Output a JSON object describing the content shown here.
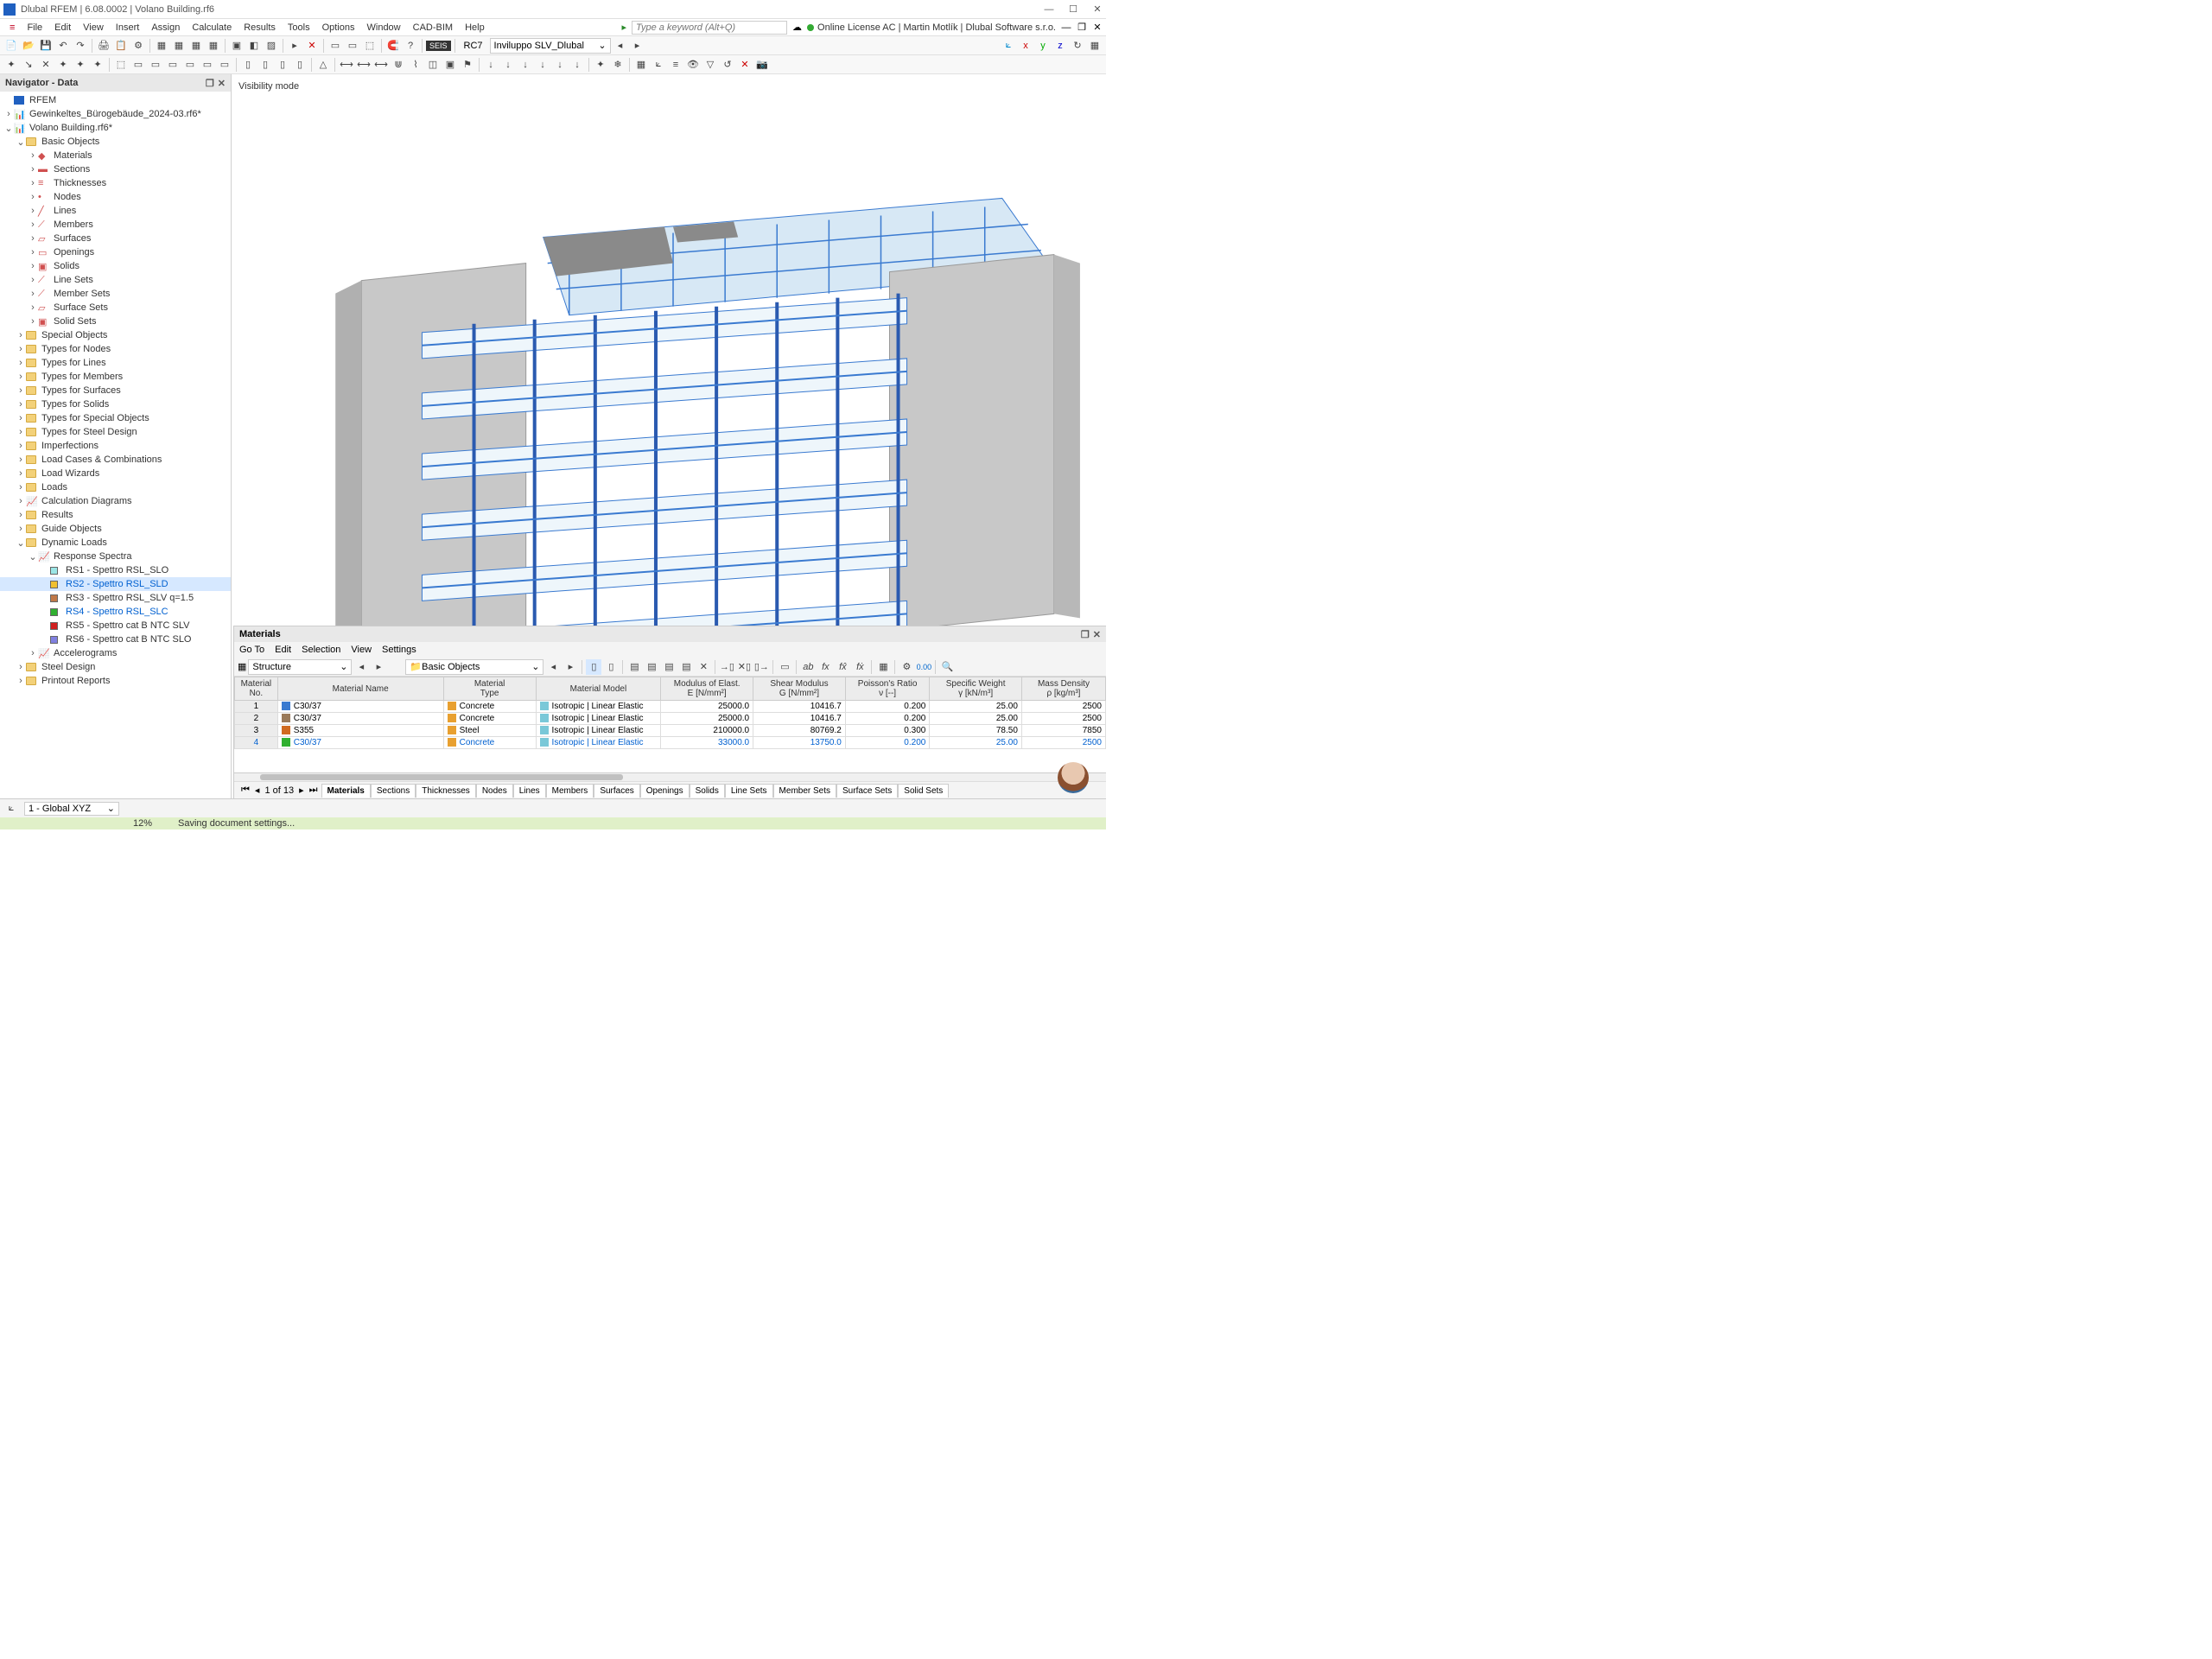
{
  "title": "Dlubal RFEM | 6.08.0002 | Volano Building.rf6",
  "menus": [
    "File",
    "Edit",
    "View",
    "Insert",
    "Assign",
    "Calculate",
    "Results",
    "Tools",
    "Options",
    "Window",
    "CAD-BIM",
    "Help"
  ],
  "keyword_placeholder": "Type a keyword (Alt+Q)",
  "license": "Online License AC | Martin Motlík | Dlubal Software s.r.o.",
  "toolbar_rc": "RC7",
  "toolbar_combo": "Inviluppo SLV_Dlubal",
  "seis_badge": "SEIS",
  "nav_title": "Navigator - Data",
  "tree": {
    "root": "RFEM",
    "f1": "Gewinkeltes_Bürogebäude_2024-03.rf6*",
    "f2": "Volano Building.rf6*",
    "basic": "Basic Objects",
    "basic_items": [
      "Materials",
      "Sections",
      "Thicknesses",
      "Nodes",
      "Lines",
      "Members",
      "Surfaces",
      "Openings",
      "Solids",
      "Line Sets",
      "Member Sets",
      "Surface Sets",
      "Solid Sets"
    ],
    "folders": [
      "Special Objects",
      "Types for Nodes",
      "Types for Lines",
      "Types for Members",
      "Types for Surfaces",
      "Types for Solids",
      "Types for Special Objects",
      "Types for Steel Design",
      "Imperfections",
      "Load Cases & Combinations",
      "Load Wizards",
      "Loads",
      "Calculation Diagrams",
      "Results",
      "Guide Objects"
    ],
    "dyn": "Dynamic Loads",
    "rs": "Response Spectra",
    "rs_items": [
      {
        "label": "RS1 - Spettro RSL_SLO",
        "c": "#9be6e6"
      },
      {
        "label": "RS2 - Spettro RSL_SLD",
        "c": "#f0c030"
      },
      {
        "label": "RS3 - Spettro RSL_SLV q=1.5",
        "c": "#c07848"
      },
      {
        "label": "RS4 - Spettro RSL_SLC",
        "c": "#30b030"
      },
      {
        "label": "RS5 - Spettro cat B NTC SLV",
        "c": "#d02020"
      },
      {
        "label": "RS6 - Spettro cat B NTC SLO",
        "c": "#8080e0"
      }
    ],
    "accel": "Accelerograms",
    "tail": [
      "Steel Design",
      "Printout Reports"
    ]
  },
  "viewport_mode": "Visibility mode",
  "panel": {
    "title": "Materials",
    "menu": [
      "Go To",
      "Edit",
      "Selection",
      "View",
      "Settings"
    ],
    "struct": "Structure",
    "basic": "Basic Objects",
    "cols": [
      "Material\nNo.",
      "Material Name",
      "Material\nType",
      "Material Model",
      "Modulus of Elast.\nE [N/mm²]",
      "Shear Modulus\nG [N/mm²]",
      "Poisson's Ratio\nν [--]",
      "Specific Weight\nγ [kN/m³]",
      "Mass Density\nρ [kg/m³]"
    ],
    "rows": [
      {
        "no": "1",
        "sw": "#3a7ad0",
        "name": "C30/37",
        "type": "Concrete",
        "model": "Isotropic | Linear Elastic",
        "E": "25000.0",
        "G": "10416.7",
        "v": "0.200",
        "gw": "25.00",
        "rho": "2500"
      },
      {
        "no": "2",
        "sw": "#9a7a5a",
        "name": "C30/37",
        "type": "Concrete",
        "model": "Isotropic | Linear Elastic",
        "E": "25000.0",
        "G": "10416.7",
        "v": "0.200",
        "gw": "25.00",
        "rho": "2500"
      },
      {
        "no": "3",
        "sw": "#d06a20",
        "name": "S355",
        "type": "Steel",
        "model": "Isotropic | Linear Elastic",
        "E": "210000.0",
        "G": "80769.2",
        "v": "0.300",
        "gw": "78.50",
        "rho": "7850"
      },
      {
        "no": "4",
        "sw": "#30b030",
        "name": "C30/37",
        "type": "Concrete",
        "model": "Isotropic | Linear Elastic",
        "E": "33000.0",
        "G": "13750.0",
        "v": "0.200",
        "gw": "25.00",
        "rho": "2500",
        "blue": true
      }
    ],
    "nav": "1 of 13",
    "tabs": [
      "Materials",
      "Sections",
      "Thicknesses",
      "Nodes",
      "Lines",
      "Members",
      "Surfaces",
      "Openings",
      "Solids",
      "Line Sets",
      "Member Sets",
      "Surface Sets",
      "Solid Sets"
    ]
  },
  "status": {
    "cs": "1 - Global XYZ",
    "pct": "12%",
    "msg": "Saving document settings..."
  }
}
